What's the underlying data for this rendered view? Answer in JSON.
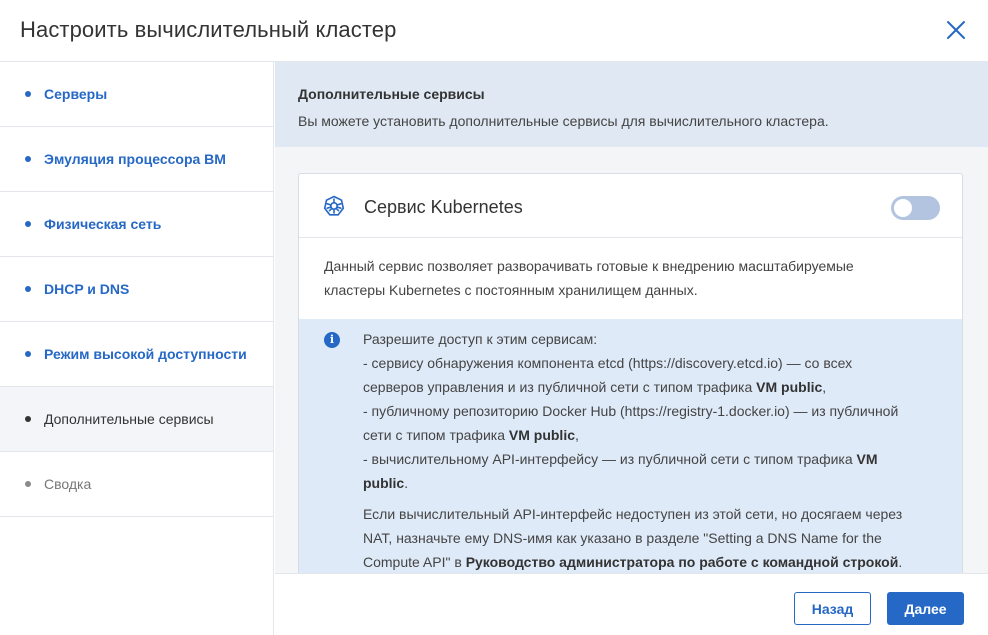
{
  "dialog": {
    "title": "Настроить вычислительный кластер"
  },
  "sidebar": {
    "items": [
      {
        "label": "Серверы",
        "state": "link"
      },
      {
        "label": "Эмуляция процессора ВМ",
        "state": "link"
      },
      {
        "label": "Физическая сеть",
        "state": "link"
      },
      {
        "label": "DHCP и DNS",
        "state": "link"
      },
      {
        "label": "Режим высокой доступности",
        "state": "link"
      },
      {
        "label": "Дополнительные сервисы",
        "state": "active"
      },
      {
        "label": "Сводка",
        "state": "disabled"
      }
    ]
  },
  "main": {
    "heading": "Дополнительные сервисы",
    "subheading": "Вы можете установить дополнительные сервисы для вычислительного кластера.",
    "card": {
      "icon": "kubernetes-icon",
      "title": "Сервис Kubernetes",
      "toggle_on": false,
      "description_line1": "Данный сервис позволяет разворачивать готовые к внедрению масштабируемые",
      "description_line2": "кластеры Kubernetes с постоянным хранилищем данных.",
      "info": {
        "l1": "Разрешите доступ к этим сервисам:",
        "l2": "- сервису обнаружения компонента etcd (https://discovery.etcd.io) — со всех",
        "l3a": "серверов управления и из публичной сети с типом трафика ",
        "l3b": "VM public",
        "l3c": ",",
        "l4": "- публичному репозиторию Docker Hub (https://registry-1.docker.io) — из публичной",
        "l5a": "сети с типом трафика ",
        "l5b": "VM public",
        "l5c": ",",
        "l6a": "- вычислительному API-интерфейсу — из публичной сети с типом трафика ",
        "l6b": "VM",
        "l7a": "public",
        "l7b": ".",
        "p2l1": "Если вычислительный API-интерфейс недоступен из этой сети, но досягаем через",
        "p2l2": "NAT, назначьте ему DNS-имя как указано в разделе \"Setting a DNS Name for the",
        "p2l3a": "Compute API\" в ",
        "p2l3b": "Руководство администратора по работе с командной строкой",
        "p2l3c": "."
      }
    }
  },
  "footer": {
    "back_label": "Назад",
    "next_label": "Далее"
  },
  "colors": {
    "accent": "#2668c5",
    "intro_bg": "#dfe8f3",
    "info_bg": "#dfeaf8",
    "toggle_off": "#b3c4e0"
  }
}
